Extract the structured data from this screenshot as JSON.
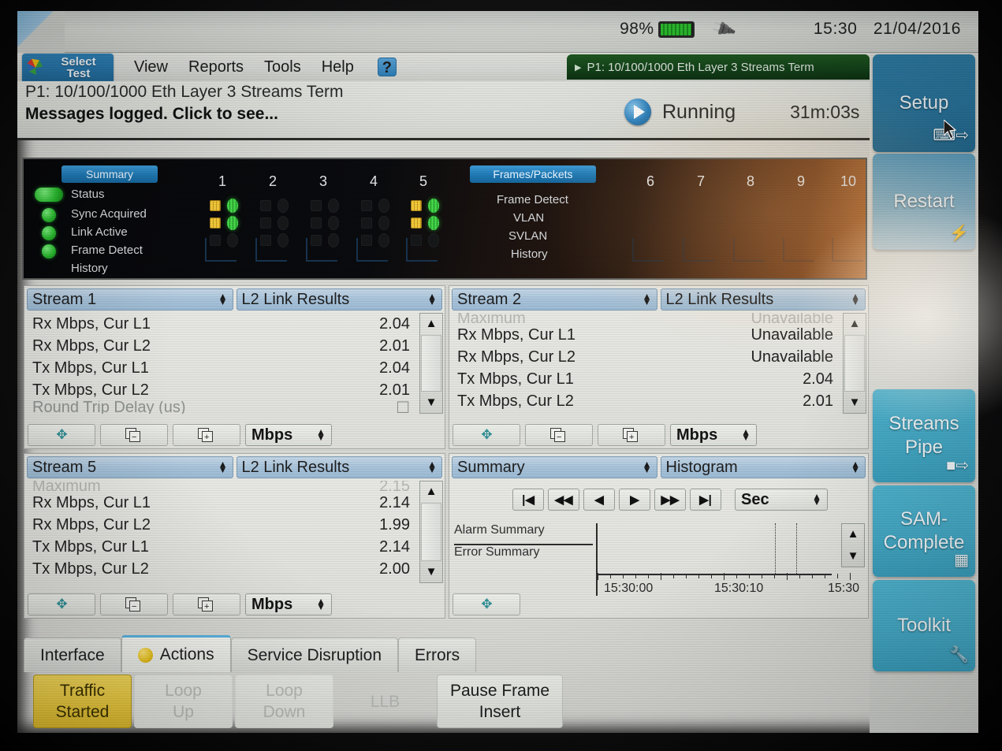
{
  "statusbar": {
    "battery_percent": "98%",
    "battery_icon": "battery-icon",
    "power_icon": "power-plug-icon",
    "time": "15:30",
    "date": "21/04/2016"
  },
  "menubar": {
    "select_test_line1": "Select",
    "select_test_line2": "Test",
    "logo_icon": "pinwheel-logo-icon",
    "items": [
      {
        "label": "View"
      },
      {
        "label": "Reports"
      },
      {
        "label": "Tools"
      },
      {
        "label": "Help"
      }
    ],
    "help_icon": "help-question-icon",
    "test_tab": "P1: 10/100/1000 Eth Layer 3 Streams Term"
  },
  "title": {
    "port": "P1: 10/100/1000 Eth Layer 3 Streams Term",
    "message": "Messages logged. Click to see...",
    "run_icon": "play-circle-icon",
    "run_state": "Running",
    "elapsed": "31m:03s"
  },
  "led_panel": {
    "left_section_label": "Summary",
    "left_legend": [
      "Status",
      "Sync Acquired",
      "Link Active",
      "Frame Detect",
      "History"
    ],
    "left_columns": [
      "1",
      "2",
      "3",
      "4",
      "5"
    ],
    "right_section_label": "Frames/Packets",
    "right_legend": [
      "Frame Detect",
      "VLAN",
      "SVLAN",
      "History"
    ],
    "right_columns": [
      "6",
      "7",
      "8",
      "9",
      "10"
    ],
    "active_columns": [
      1,
      5
    ]
  },
  "panes": [
    {
      "id": "pane-stream-1",
      "source": "Stream 1",
      "view": "L2 Link Results",
      "top_partial": null,
      "rows": [
        {
          "label": "Rx Mbps, Cur L1",
          "value": "2.04"
        },
        {
          "label": "Rx Mbps, Cur L2",
          "value": "2.01"
        },
        {
          "label": "Tx Mbps, Cur L1",
          "value": "2.04"
        },
        {
          "label": "Tx Mbps, Cur L2",
          "value": "2.01"
        }
      ],
      "bottom_partial": "Round Trip Delay (us)",
      "unit": "Mbps"
    },
    {
      "id": "pane-stream-2",
      "source": "Stream 2",
      "view": "L2 Link Results",
      "top_partial": {
        "label": "Maximum",
        "value": "Unavailable"
      },
      "rows": [
        {
          "label": "Rx Mbps, Cur L1",
          "value": "Unavailable"
        },
        {
          "label": "Rx Mbps, Cur L2",
          "value": "Unavailable"
        },
        {
          "label": "Tx Mbps, Cur L1",
          "value": "2.04"
        },
        {
          "label": "Tx Mbps, Cur L2",
          "value": "2.01"
        }
      ],
      "bottom_partial": null,
      "unit": "Mbps"
    },
    {
      "id": "pane-stream-5",
      "source": "Stream 5",
      "view": "L2 Link Results",
      "top_partial": {
        "label": "Maximum",
        "value": "2.15"
      },
      "rows": [
        {
          "label": "Rx Mbps, Cur L1",
          "value": "2.14"
        },
        {
          "label": "Rx Mbps, Cur L2",
          "value": "1.99"
        },
        {
          "label": "Tx Mbps, Cur L1",
          "value": "2.14"
        },
        {
          "label": "Tx Mbps, Cur L2",
          "value": "2.00"
        }
      ],
      "bottom_partial": null,
      "unit": "Mbps"
    }
  ],
  "histogram_pane": {
    "id": "pane-summary-histogram",
    "source": "Summary",
    "view": "Histogram",
    "nav_buttons": [
      {
        "name": "jump-first-button",
        "glyph": "|◀"
      },
      {
        "name": "rewind-button",
        "glyph": "◀◀"
      },
      {
        "name": "step-back-button",
        "glyph": "◀"
      },
      {
        "name": "step-forward-button",
        "glyph": "▶"
      },
      {
        "name": "fast-forward-button",
        "glyph": "▶▶"
      },
      {
        "name": "jump-last-button",
        "glyph": "▶|"
      }
    ],
    "interval_unit": "Sec",
    "row_labels": [
      "Alarm Summary",
      "Error Summary"
    ],
    "axis_labels": [
      "15:30:00",
      "15:30:10",
      "15:30"
    ]
  },
  "chart_data": {
    "type": "bar",
    "title": "Histogram",
    "xlabel": "",
    "ylabel": "",
    "categories": [
      "Alarm Summary",
      "Error Summary"
    ],
    "values": [
      0,
      0
    ],
    "x_tick_labels": [
      "15:30:00",
      "15:30:10",
      "15:30"
    ],
    "x_axis_unit": "Sec",
    "grid": false,
    "legend": "none",
    "annotations": [
      "cursor-band"
    ]
  },
  "pane_footer": {
    "move_icon": "move-4way-icon",
    "remove_pane_icon": "remove-pane-icon",
    "add_pane_icon": "add-pane-icon",
    "unit": "Mbps"
  },
  "tabs": [
    {
      "label": "Interface",
      "active": false,
      "dot": false
    },
    {
      "label": "Actions",
      "active": true,
      "dot": true
    },
    {
      "label": "Service Disruption",
      "active": false,
      "dot": false
    },
    {
      "label": "Errors",
      "active": false,
      "dot": false
    }
  ],
  "actions": [
    {
      "line1": "Traffic",
      "line2": "Started",
      "state": "on"
    },
    {
      "line1": "Loop",
      "line2": "Up",
      "state": "disabled"
    },
    {
      "line1": "Loop",
      "line2": "Down",
      "state": "disabled"
    },
    {
      "line1": "LLB",
      "line2": "",
      "state": "disabled-ghost"
    },
    {
      "line1": "Pause Frame",
      "line2": "Insert",
      "state": "normal"
    }
  ],
  "sidebar": [
    {
      "label1": "Setup",
      "label2": "",
      "icon": "setup-pointer-icon",
      "key": "setup"
    },
    {
      "label1": "Restart",
      "label2": "",
      "icon": "restart-bolt-icon",
      "key": "restart"
    },
    {
      "label1": "Streams",
      "label2": "Pipe",
      "icon": "streams-pipe-icon",
      "key": "streams"
    },
    {
      "label1": "SAM-",
      "label2": "Complete",
      "icon": "sam-complete-icon",
      "key": "sam"
    },
    {
      "label1": "Toolkit",
      "label2": "",
      "icon": "toolkit-tools-icon",
      "key": "toolkit"
    }
  ],
  "colors": {
    "accent_blue": "#2f83b8",
    "teal_button": "#45aac7",
    "active_yellow": "#e9c93f",
    "led_green": "#2cbe31",
    "tab_highlight": "#59b3e0"
  }
}
